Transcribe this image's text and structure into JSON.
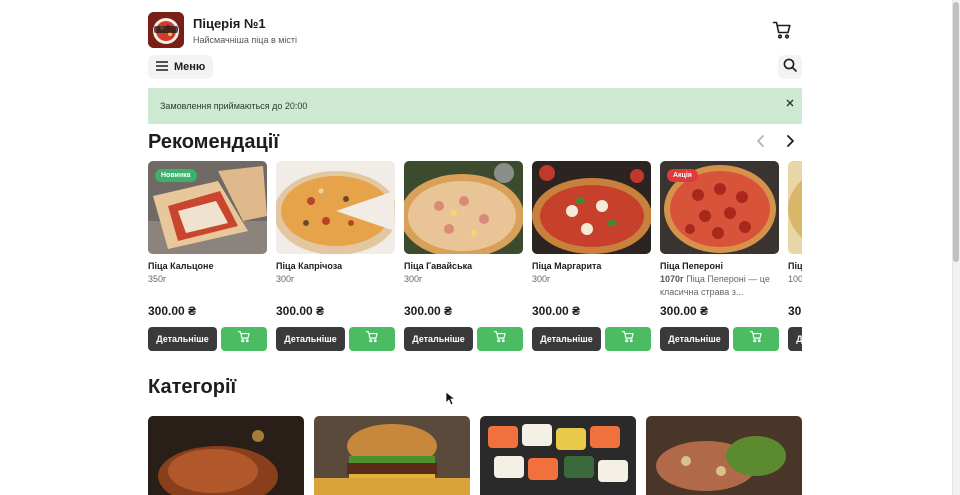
{
  "header": {
    "title": "Піцерія №1",
    "subtitle": "Найсмачніша піца в місті",
    "logo_icon": "pizzeria-logo",
    "cart_icon": "cart-icon"
  },
  "nav": {
    "menu_label": "Меню",
    "menu_icon": "hamburger-icon",
    "search_icon": "search-icon"
  },
  "notice": {
    "text": "Замовлення приймаються до 20:00",
    "close_icon": "close-icon",
    "background": "#cde9d2"
  },
  "recommendations": {
    "title": "Рекомендації",
    "prev_icon": "chevron-left-icon",
    "next_icon": "chevron-right-icon",
    "details_label": "Детальніше",
    "products": [
      {
        "name": "Піца Кальцоне",
        "weight": "350г",
        "description": "",
        "price": "300.00 ₴",
        "badge": "Новинка",
        "badge_color": "#3bb36a"
      },
      {
        "name": "Піца Капрічоза",
        "weight": "300г",
        "description": "",
        "price": "300.00 ₴",
        "badge": "",
        "badge_color": ""
      },
      {
        "name": "Піца Гавайська",
        "weight": "300г",
        "description": "",
        "price": "300.00 ₴",
        "badge": "",
        "badge_color": ""
      },
      {
        "name": "Піца Маргарита",
        "weight": "300г",
        "description": "",
        "price": "300.00 ₴",
        "badge": "",
        "badge_color": ""
      },
      {
        "name": "Піца Пепероні",
        "weight": "1070г",
        "description": "Піца Пепероні — це класична страва з...",
        "price": "300.00 ₴",
        "badge": "Акція",
        "badge_color": "#e03a3a"
      },
      {
        "name": "Піц",
        "weight": "100",
        "description": "",
        "price": "30",
        "badge": "",
        "badge_color": ""
      }
    ]
  },
  "categories": {
    "title": "Категорії"
  },
  "colors": {
    "accent_green": "#4cbc62",
    "dark_button": "#3a3a3c"
  }
}
